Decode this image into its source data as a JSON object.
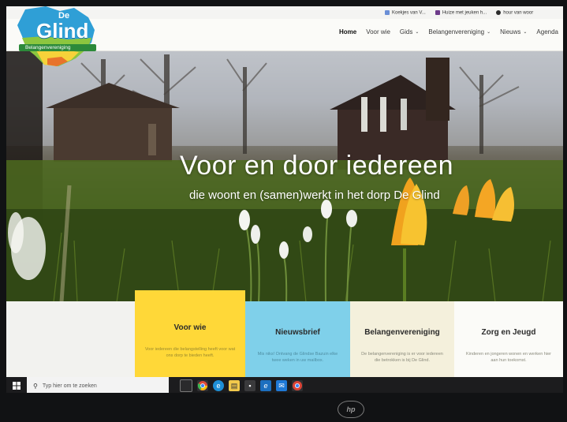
{
  "bookmarks": [
    {
      "label": "Koekjes van V...",
      "color": "#6b8fd6"
    },
    {
      "label": "Huize met jeuken h...",
      "color": "#6d3b8a"
    },
    {
      "label": "hour van woor",
      "color": "#2b2b2b"
    }
  ],
  "logo": {
    "top_text": "De",
    "name": "Glind",
    "tagline": "Belangenvereniging"
  },
  "nav": {
    "items": [
      {
        "label": "Home",
        "active": true,
        "has_dropdown": false
      },
      {
        "label": "Voor wie",
        "active": false,
        "has_dropdown": false
      },
      {
        "label": "Gids",
        "active": false,
        "has_dropdown": true
      },
      {
        "label": "Belangenvereniging",
        "active": false,
        "has_dropdown": true
      },
      {
        "label": "Nieuws",
        "active": false,
        "has_dropdown": true
      },
      {
        "label": "Agenda",
        "active": false,
        "has_dropdown": false
      }
    ]
  },
  "hero": {
    "title": "Voor en door iedereen",
    "subtitle": "die woont en (samen)werkt in het dorp De Glind"
  },
  "cards": [
    {
      "title": "",
      "text": ""
    },
    {
      "title": "Voor wie",
      "text": "Voor iedereen die belangstelling heeft voor wat ons dorp te bieden heeft."
    },
    {
      "title": "Nieuwsbrief",
      "text": "Mis niks! Ontvang de Glindse Bazuin elke twee weken in uw mailbox."
    },
    {
      "title": "Belangenvereniging",
      "text": "De belangenvereniging is er voor iedereen die betrokken is bij De Glind."
    },
    {
      "title": "Zorg en Jeugd",
      "text": "Kinderen en jongeren wonen en werken hier aan hun toekomst."
    }
  ],
  "taskbar": {
    "search_placeholder": "Typ hier om te zoeken",
    "icons": [
      "task-view-icon",
      "chrome-icon",
      "edge-icon",
      "file-explorer-icon",
      "store-icon",
      "ie-icon",
      "mail-icon",
      "chrome-profile-icon"
    ]
  },
  "monitor": {
    "brand": "hp"
  }
}
